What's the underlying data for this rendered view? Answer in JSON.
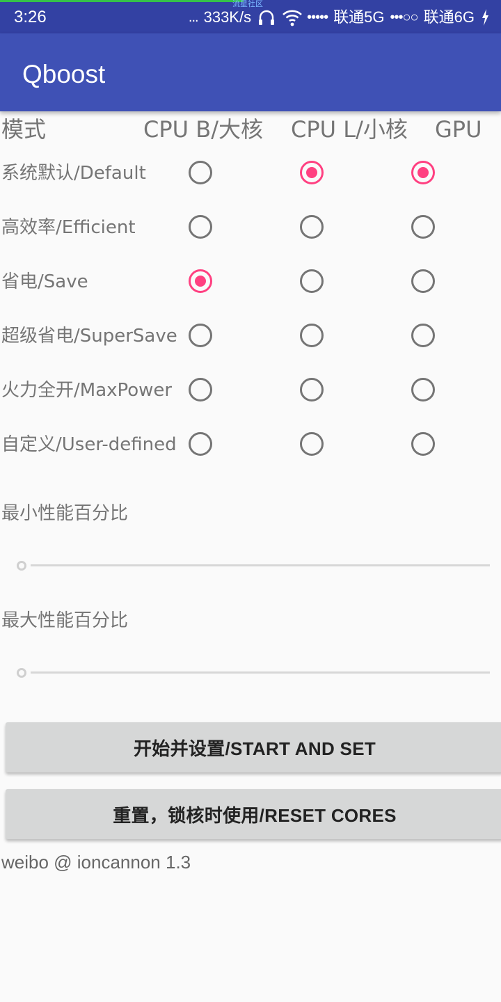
{
  "status_bar": {
    "time": "3:26",
    "dots": "...",
    "speed": "333K/s",
    "center_tag": "流星社区",
    "carrier1": "联通5G",
    "carrier2": "联通6G",
    "signal1": "•••••",
    "signal2": "•••○○",
    "icons": [
      "headphones-icon",
      "wifi-icon",
      "charging-icon"
    ]
  },
  "app_bar": {
    "title": "Qboost"
  },
  "table": {
    "headers": {
      "mode": "模式",
      "cpu_big": "CPU B/大核",
      "cpu_little": "CPU L/小核",
      "gpu": "GPU"
    },
    "rows": [
      {
        "label": "系统默认/Default",
        "cpu_big": false,
        "cpu_little": true,
        "gpu": true
      },
      {
        "label": "高效率/Efficient",
        "cpu_big": false,
        "cpu_little": false,
        "gpu": false
      },
      {
        "label": "省电/Save",
        "cpu_big": true,
        "cpu_little": false,
        "gpu": false
      },
      {
        "label": "超级省电/SuperSave",
        "cpu_big": false,
        "cpu_little": false,
        "gpu": false
      },
      {
        "label": "火力全开/MaxPower",
        "cpu_big": false,
        "cpu_little": false,
        "gpu": false
      },
      {
        "label": "自定义/User-defined",
        "cpu_big": false,
        "cpu_little": false,
        "gpu": false
      }
    ]
  },
  "min_perf": {
    "label": "最小性能百分比",
    "value": 0
  },
  "max_perf": {
    "label": "最大性能百分比",
    "value": 0
  },
  "buttons": {
    "start": "开始并设置/START AND SET",
    "reset": "重置，锁核时使用/RESET CORES"
  },
  "footer": "weibo @ ioncannon 1.3",
  "colors": {
    "status_bar": "#3341a3",
    "app_bar": "#3f51b5",
    "accent": "#ff4081",
    "background": "#fafafa"
  }
}
